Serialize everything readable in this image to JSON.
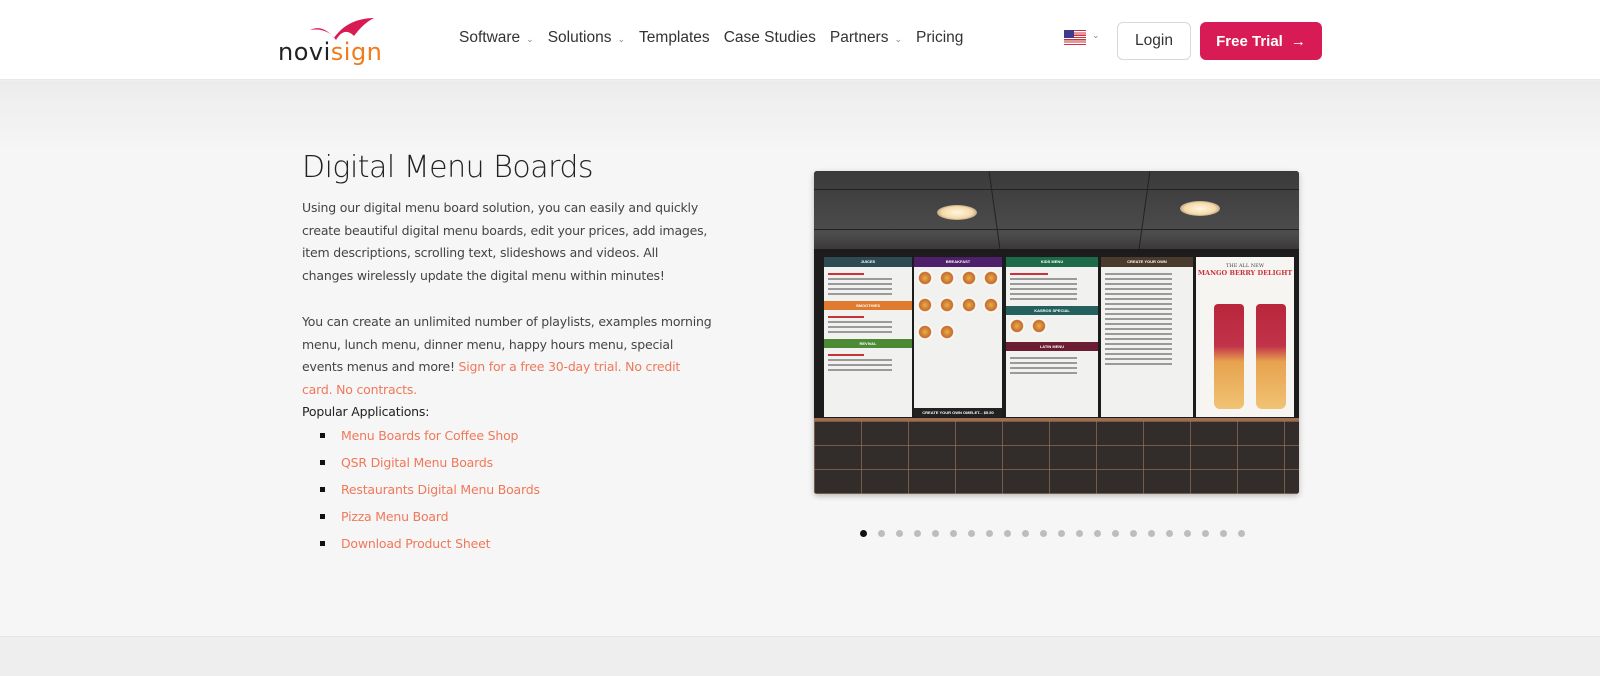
{
  "header": {
    "logo": {
      "part1": "novi",
      "part2": "sign",
      "brand_colors": {
        "text": "#222222",
        "accent": "#f07b1b",
        "swoosh": "#d81b55"
      }
    },
    "nav": [
      {
        "label": "Software",
        "has_dropdown": true
      },
      {
        "label": "Solutions",
        "has_dropdown": true
      },
      {
        "label": "Templates",
        "has_dropdown": false
      },
      {
        "label": "Case Studies",
        "has_dropdown": false
      },
      {
        "label": "Partners",
        "has_dropdown": true
      },
      {
        "label": "Pricing",
        "has_dropdown": false
      }
    ],
    "language": {
      "icon": "us-flag-icon"
    },
    "login_label": "Login",
    "trial_label": "Free Trial",
    "trial_icon": "→",
    "accent_color": "#d81b55"
  },
  "content": {
    "title": "Digital Menu Boards",
    "paragraph1": "Using our digital menu board solution, you can easily and quickly create beautiful digital menu boards, edit your prices, add images, item descriptions, scrolling text, slideshows and videos. All changes wirelessly update the digital menu within minutes!",
    "paragraph2_text": "You can create an unlimited number of playlists, examples morning menu, lunch menu, dinner menu, happy hours menu, special events menus and more! ",
    "paragraph2_link": "Sign for a free 30-day trial. No credit card. No contracts.",
    "apps_label": "Popular Applications:",
    "apps": [
      "Menu Boards for Coffee Shop",
      "QSR Digital Menu Boards",
      "Restaurants Digital Menu Boards",
      "Pizza Menu Board",
      "Download Product Sheet"
    ],
    "link_color": "#f0785a"
  },
  "slider": {
    "image_panels": [
      {
        "title": "JUICES",
        "sections": [
          "SMOOTHIES",
          "REVIVAL"
        ]
      },
      {
        "title": "BREAKFAST",
        "footer": "CREATE YOUR OWN OMELET... $5.50"
      },
      {
        "title": "KIDS MENU",
        "sections": [
          "KASROS SPECIAL",
          "LATIN MENU"
        ]
      },
      {
        "title": "CREATE YOUR OWN"
      },
      {
        "title": "THE ALL NEW",
        "subtitle": "MANGO BERRY DELIGHT"
      }
    ],
    "total_slides": 22,
    "active_slide": 1
  }
}
